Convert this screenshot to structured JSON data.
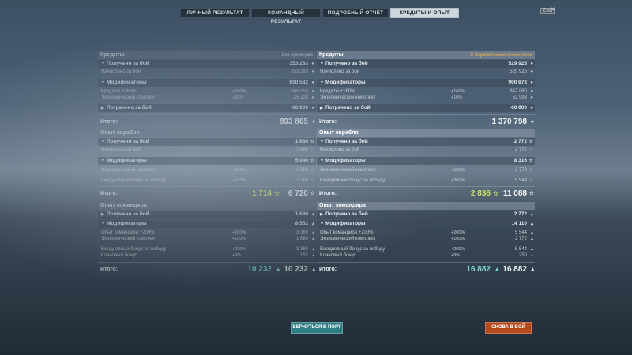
{
  "tabs": [
    {
      "label": "ЛИЧНЫЙ РЕЗУЛЬТАТ",
      "active": false
    },
    {
      "label": "КОМАНДНЫЙ РЕЗУЛЬТАТ",
      "active": false
    },
    {
      "label": "ПОДРОБНЫЙ ОТЧЁТ",
      "active": false
    },
    {
      "label": "КРЕДИТЫ И ОПЫТ",
      "active": true
    }
  ],
  "hotkey": "ESC",
  "close_glyph": "×",
  "left": {
    "credits_header": "Кредиты",
    "credits_note": "Без премиума",
    "received_label": "Получено за бой",
    "received_value": "353 283",
    "earned_label": "Начислено за бой",
    "earned_value": "353 283",
    "mods_label": "Модификаторы",
    "mods_value": "600 582",
    "credits160_label": "Кредиты +160%",
    "credits160_pct": "+160%",
    "credits160_value": "565 253",
    "econ_label": "Экономический комплект",
    "econ_pct": "+10%",
    "econ_value": "35 328",
    "spent_label": "Потрачено за бой",
    "spent_value": "-60 000",
    "total_label": "Итого:",
    "credits_total": "893 865",
    "ship_header": "Опыт корабля",
    "ship_received_value": "1 680",
    "ship_earned_value": "1 680",
    "ship_mods_value": "5 040",
    "ship_econ_pct": "+100%",
    "ship_econ_value": "1 680",
    "daily_label": "Ежедневный бонус за победу",
    "ship_daily_pct": "+200%",
    "ship_daily_value": "3 360",
    "ship_total_free": "1 714",
    "ship_total": "6 720",
    "cmd_header": "Опыт командира",
    "cmd_received_value": "1 680",
    "cmd_mods_value": "8 552",
    "cmd200_label": "Опыт командира +200%",
    "cmd200_pct": "+200%",
    "cmd200_value": "3 360",
    "cmd_econ_pct": "+100%",
    "cmd_econ_value": "1 680",
    "cmd_daily_pct": "+200%",
    "cmd_daily_value": "3 360",
    "clan_label": "Клановый бонус",
    "clan_pct": "+9%",
    "clan_value": "152",
    "cmd_total_a": "10 232",
    "cmd_total_b": "10 232"
  },
  "right": {
    "credits_header": "Кредиты",
    "credits_note": "С Корабельным премиумом",
    "received_value": "529 925",
    "earned_value": "529 925",
    "mods_value": "900 873",
    "credits160_pct": "+160%",
    "credits160_value": "847 880",
    "econ_pct": "+10%",
    "econ_value": "52 993",
    "spent_value": "-60 000",
    "credits_total": "1 370 798",
    "ship_received_value": "2 772",
    "ship_earned_value": "2 772",
    "ship_mods_value": "8 316",
    "ship_econ_pct": "+100%",
    "ship_econ_value": "2 772",
    "ship_daily_pct": "+200%",
    "ship_daily_value": "5 544",
    "ship_total_free": "2 836",
    "ship_total": "11 088",
    "cmd_received_value": "2 772",
    "cmd_mods_value": "14 110",
    "cmd200_pct": "+200%",
    "cmd200_value": "5 544",
    "cmd_econ_pct": "+100%",
    "cmd_econ_value": "2 772",
    "cmd_daily_pct": "+200%",
    "cmd_daily_value": "5 544",
    "clan_pct": "+9%",
    "clan_value": "250",
    "cmd_total_a": "16 882",
    "cmd_total_b": "16 882"
  },
  "buttons": {
    "port": "ВЕРНУТЬСЯ В ПОРТ",
    "battle": "СНОВА В БОЙ"
  },
  "colors": {
    "premium_accent": "#f0b24a",
    "free_xp": "#c9e06a",
    "commander_xp": "#7fd8d6",
    "port_button": "#2f7e84",
    "battle_button": "#b6491c"
  },
  "icons": {
    "credits": "credits-icon",
    "ship_xp": "star-icon",
    "commander_xp": "commander-icon",
    "expand": "triangle-icon"
  }
}
